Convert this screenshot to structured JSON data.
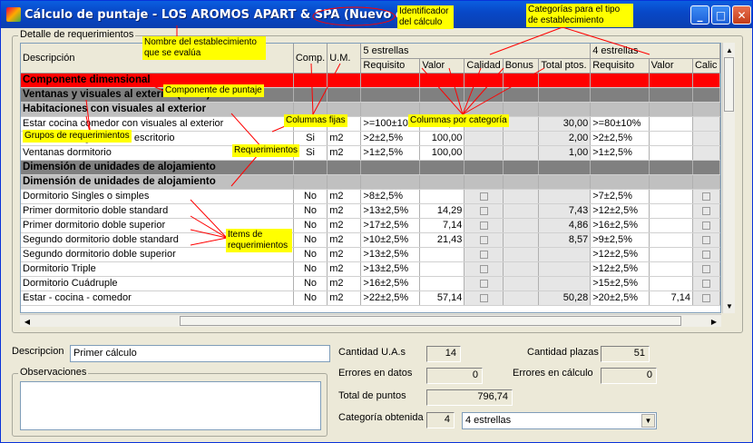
{
  "window": {
    "title": "Cálculo de puntaje - LOS AROMOS APART & SPA (Nuevo cálculo)"
  },
  "detail_group": {
    "label": "Detalle de requerimientos"
  },
  "grid": {
    "header": {
      "desc": "Descripción",
      "comp": "Comp.",
      "um": "U.M.",
      "cat1": "5 estrellas",
      "cat2": "4 estrellas",
      "requisito": "Requisito",
      "valor": "Valor",
      "calidad": "Calidad",
      "bonus": "Bonus",
      "total": "Total ptos.",
      "requisito2": "Requisito",
      "valor2": "Valor",
      "calidad2": "Calic"
    },
    "rows": [
      {
        "type": "red",
        "desc": "Componente dimensional"
      },
      {
        "type": "dg",
        "desc": "Ventanas y visuales al exterior (art 5°)"
      },
      {
        "type": "lg",
        "desc": "Habitaciones con visuales al exterior"
      },
      {
        "type": "item",
        "desc": "Estar cocina comedor con visuales al exterior",
        "comp": "Si",
        "um": "%",
        "req": ">=100±10%",
        "val": "100,00",
        "total": "30,00",
        "req2": ">=80±10%",
        "val2": ""
      },
      {
        "type": "item",
        "desc": "Ventanas living comedor escritorio",
        "comp": "Si",
        "um": "m2",
        "req": ">2±2,5%",
        "val": "100,00",
        "total": "2,00",
        "req2": ">2±2,5%",
        "val2": ""
      },
      {
        "type": "item",
        "desc": "Ventanas dormitorio",
        "comp": "Si",
        "um": "m2",
        "req": ">1±2,5%",
        "val": "100,00",
        "total": "1,00",
        "req2": ">1±2,5%",
        "val2": ""
      },
      {
        "type": "dg",
        "desc": "Dimensión de unidades de alojamiento"
      },
      {
        "type": "lg",
        "desc": "Dimensión de unidades de alojamiento"
      },
      {
        "type": "item",
        "chk": true,
        "desc": "Dormitorio Singles o simples",
        "comp": "No",
        "um": "m2",
        "req": ">8±2,5%",
        "val": "",
        "total": "",
        "req2": ">7±2,5%",
        "val2": ""
      },
      {
        "type": "item",
        "chk": true,
        "desc": "Primer dormitorio doble standard",
        "comp": "No",
        "um": "m2",
        "req": ">13±2,5%",
        "val": "14,29",
        "total": "7,43",
        "req2": ">12±2,5%",
        "val2": ""
      },
      {
        "type": "item",
        "chk": true,
        "desc": "Primer dormitorio doble superior",
        "comp": "No",
        "um": "m2",
        "req": ">17±2,5%",
        "val": "7,14",
        "total": "4,86",
        "req2": ">16±2,5%",
        "val2": ""
      },
      {
        "type": "item",
        "chk": true,
        "desc": "Segundo dormitorio doble standard",
        "comp": "No",
        "um": "m2",
        "req": ">10±2,5%",
        "val": "21,43",
        "total": "8,57",
        "req2": ">9±2,5%",
        "val2": ""
      },
      {
        "type": "item",
        "chk": true,
        "desc": "Segundo dormitorio doble superior",
        "comp": "No",
        "um": "m2",
        "req": ">13±2,5%",
        "val": "",
        "total": "",
        "req2": ">12±2,5%",
        "val2": ""
      },
      {
        "type": "item",
        "chk": true,
        "desc": "Dormitorio Triple",
        "comp": "No",
        "um": "m2",
        "req": ">13±2,5%",
        "val": "",
        "total": "",
        "req2": ">12±2,5%",
        "val2": ""
      },
      {
        "type": "item",
        "chk": true,
        "desc": "Dormitorio Cuádruple",
        "comp": "No",
        "um": "m2",
        "req": ">16±2,5%",
        "val": "",
        "total": "",
        "req2": ">15±2,5%",
        "val2": ""
      },
      {
        "type": "item",
        "chk": true,
        "desc": "Estar - cocina - comedor",
        "comp": "No",
        "um": "m2",
        "req": ">22±2,5%",
        "val": "57,14",
        "total": "50,28",
        "req2": ">20±2,5%",
        "val2": "7,14"
      }
    ]
  },
  "form": {
    "descripcion_label": "Descripcion",
    "descripcion_value": "Primer cálculo",
    "observaciones_label": "Observaciones",
    "cantidad_ua_label": "Cantidad U.A.s",
    "cantidad_ua_value": "14",
    "cantidad_plazas_label": "Cantidad plazas",
    "cantidad_plazas_value": "51",
    "errores_datos_label": "Errores en datos",
    "errores_datos_value": "0",
    "errores_calculo_label": "Errores en cálculo",
    "errores_calculo_value": "0",
    "total_puntos_label": "Total de puntos",
    "total_puntos_value": "796,74",
    "categoria_label": "Categoría obtenida",
    "categoria_num": "4",
    "categoria_value": "4 estrellas"
  },
  "annotations": {
    "identificador": "Identificador\ndel cálculo",
    "categorias": "Categorías para el tipo\nde establecimiento",
    "nombre": "Nombre del establecimiento\nque se evalúa",
    "componente": "Componente de puntaje",
    "grupos": "Grupos de requerimientos",
    "columnas_fijas": "Columnas fijas",
    "columnas_categoria": "Columnas por categoría",
    "requerimientos": "Requerimientos",
    "items": "Items de\nrequerimientos"
  }
}
